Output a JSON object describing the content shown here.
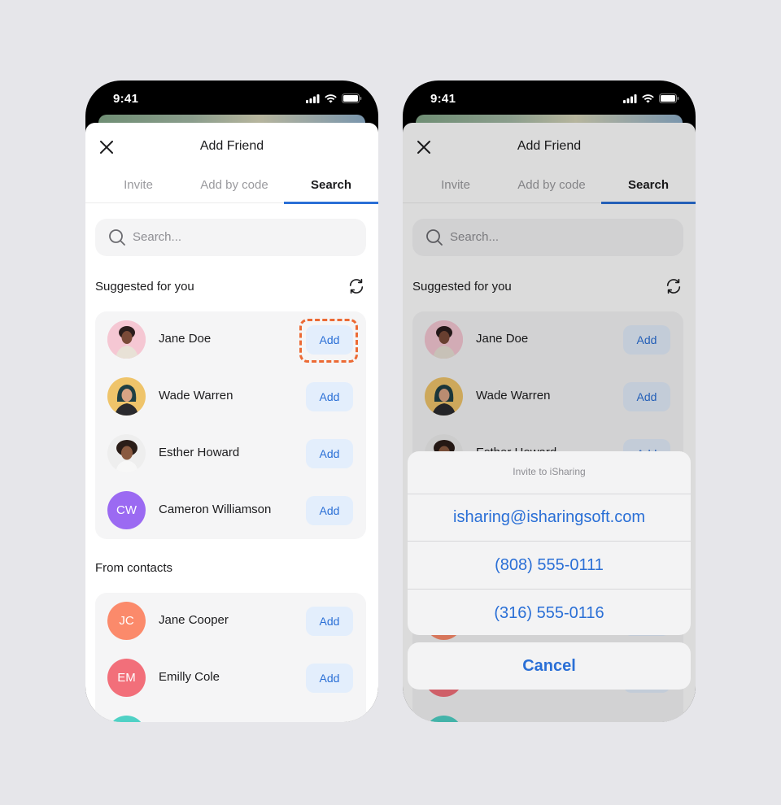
{
  "status": {
    "time": "9:41"
  },
  "header": {
    "title": "Add Friend"
  },
  "tabs": [
    {
      "label": "Invite"
    },
    {
      "label": "Add by code"
    },
    {
      "label": "Search"
    }
  ],
  "search": {
    "placeholder": "Search..."
  },
  "suggested": {
    "title": "Suggested for you",
    "items": [
      {
        "name": "Jane Doe",
        "add_label": "Add"
      },
      {
        "name": "Wade Warren",
        "add_label": "Add"
      },
      {
        "name": "Esther Howard",
        "add_label": "Add"
      },
      {
        "name": "Cameron Williamson",
        "initials": "CW",
        "add_label": "Add"
      }
    ]
  },
  "contacts": {
    "title": "From contacts",
    "items": [
      {
        "name": "Jane Cooper",
        "initials": "JC",
        "add_label": "Add"
      },
      {
        "name": "Emilly Cole",
        "initials": "EM",
        "add_label": "Add"
      }
    ]
  },
  "action_sheet": {
    "title": "Invite to iSharing",
    "options": [
      "isharing@isharingsoft.com",
      "(808) 555-0111",
      "(316) 555-0116"
    ],
    "cancel": "Cancel"
  },
  "colors": {
    "accent": "#2a6fd6",
    "highlight": "#ec6a34",
    "avatar_cw": "#9b6af2",
    "avatar_jc": "#fb8a6b",
    "avatar_em": "#f26f7a"
  }
}
